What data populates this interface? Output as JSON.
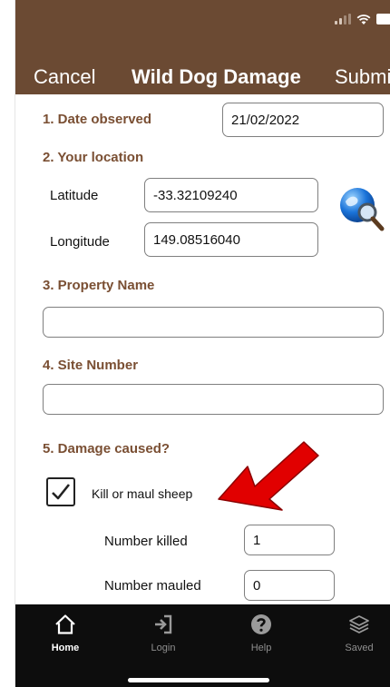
{
  "header": {
    "cancel_label": "Cancel",
    "title": "Wild Dog Damage",
    "submit_label": "Submit",
    "background_color": "#6b4a33"
  },
  "form": {
    "date": {
      "label": "1. Date observed",
      "value": "21/02/2022"
    },
    "location": {
      "label": "2. Your location",
      "latitude_label": "Latitude",
      "latitude_value": "-33.32109240",
      "longitude_label": "Longitude",
      "longitude_value": "149.08516040",
      "locate_icon": "globe-search-icon"
    },
    "property": {
      "label": "3. Property Name",
      "value": ""
    },
    "site": {
      "label": "4. Site Number",
      "value": ""
    },
    "damage": {
      "label": "5. Damage caused?",
      "kill_maul_sheep_label": "Kill or maul sheep",
      "kill_maul_sheep_checked": true,
      "number_killed_label": "Number killed",
      "number_killed_value": "1",
      "number_mauled_label": "Number mauled",
      "number_mauled_value": "0"
    },
    "label_color": "#7a4f33"
  },
  "annotation": {
    "arrow_color": "#e10000"
  },
  "tabbar": {
    "tabs": [
      {
        "label": "Home",
        "icon": "home-icon",
        "active": true
      },
      {
        "label": "Login",
        "icon": "login-icon",
        "active": false
      },
      {
        "label": "Help",
        "icon": "help-icon",
        "active": false
      },
      {
        "label": "Saved",
        "icon": "saved-icon",
        "active": false
      }
    ]
  }
}
